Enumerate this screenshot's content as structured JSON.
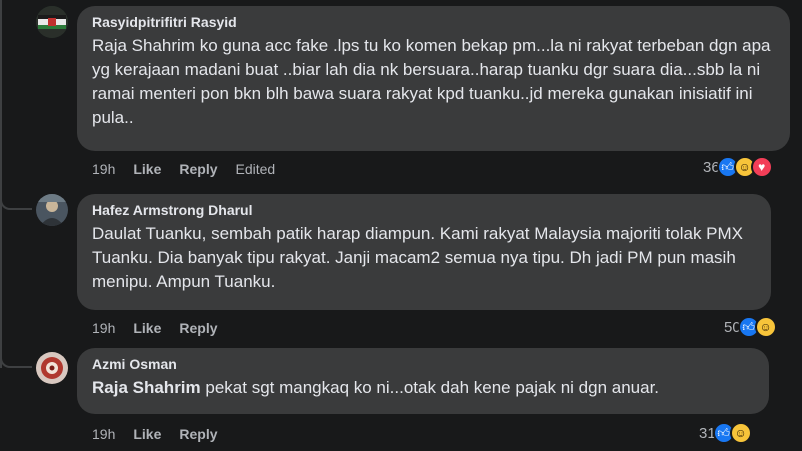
{
  "comments": [
    {
      "author": "Rasyidpitrifitri Rasyid",
      "text": "Raja Shahrim ko guna acc fake .lps tu ko komen bekap pm...la ni rakyat terbeban dgn apa yg kerajaan madani buat ..biar lah dia nk bersuara..harap tuanku dgr suara dia...sbb la ni ramai menteri pon bkn blh bawa suara rakyat kpd tuanku..jd mereka gunakan inisiatif ini pula..",
      "time": "19h",
      "like": "Like",
      "reply": "Reply",
      "edited": "Edited",
      "reaction_count": "36",
      "reactions": [
        "like-icon",
        "haha-icon",
        "love-icon"
      ]
    },
    {
      "author": "Hafez Armstrong Dharul",
      "text": "Daulat Tuanku, sembah patik harap diampun. Kami rakyat Malaysia majoriti tolak PMX Tuanku. Dia banyak tipu rakyat. Janji macam2 semua nya tipu. Dh jadi PM pun masih menipu. Ampun Tuanku.",
      "time": "19h",
      "like": "Like",
      "reply": "Reply",
      "reaction_count": "50",
      "reactions": [
        "like-icon",
        "haha-icon"
      ]
    },
    {
      "author": "Azmi Osman",
      "mention": "Raja Shahrim",
      "text": " pekat sgt mangkaq ko ni...otak dah kene pajak ni dgn anuar.",
      "time": "19h",
      "like": "Like",
      "reply": "Reply",
      "reaction_count": "31",
      "reactions": [
        "like-icon",
        "haha-icon"
      ]
    }
  ],
  "colors": {
    "background": "#18191a",
    "bubble": "#3a3b3c",
    "text": "#e4e6eb",
    "muted": "#b0b3b8",
    "like": "#1877f2",
    "haha": "#f7c43a",
    "love": "#f33e58"
  }
}
